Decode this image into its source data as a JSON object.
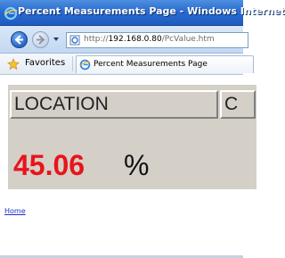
{
  "window": {
    "title": "Percent Measurements Page - Windows Internet",
    "icon": "ie-logo-icon"
  },
  "address_bar": {
    "url_prefix": "http://",
    "url_host": "192.168.0.80",
    "url_path": "/PcValue.htm"
  },
  "favorites_bar": {
    "favorites_label": "Favorites",
    "tab_label": "Percent Measurements Page"
  },
  "page": {
    "header_location": "LOCATION",
    "header_next": "C",
    "value": "45.06",
    "unit": "%",
    "home_link": "Home",
    "value_color": "#e8141c"
  }
}
